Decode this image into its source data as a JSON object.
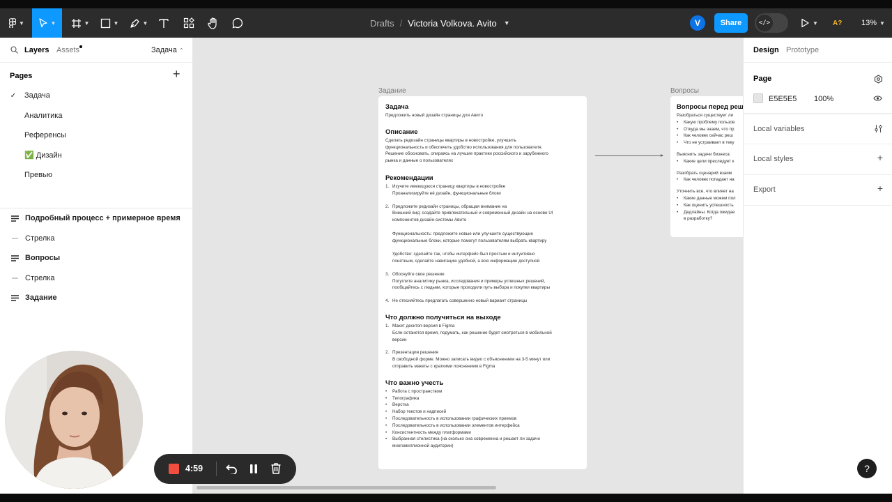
{
  "toolbar": {
    "breadcrumb_drafts": "Drafts",
    "breadcrumb_sep": "/",
    "file_name": "Victoria Volkova. Avito",
    "avatar_initial": "V",
    "share": "Share",
    "devmode_glyph": "</>",
    "ai": "A?",
    "zoom": "13%"
  },
  "left_panel": {
    "tab_layers": "Layers",
    "tab_assets": "Assets",
    "current_page": "Задача",
    "pages_heading": "Pages",
    "pages": [
      {
        "label": "Задача",
        "checked": true
      },
      {
        "label": "Аналитика"
      },
      {
        "label": "Референсы"
      },
      {
        "label": "✅ Дизайн"
      },
      {
        "label": "Превью"
      }
    ],
    "layers": [
      {
        "label": "Подробный процесс + примерное время",
        "type": "frame"
      },
      {
        "label": "Стрелка",
        "type": "line"
      },
      {
        "label": "Вопросы",
        "type": "frame"
      },
      {
        "label": "Стрелка",
        "type": "line"
      },
      {
        "label": "Задание",
        "type": "frame"
      }
    ]
  },
  "canvas": {
    "background": "#E5E5E5",
    "task_frame": {
      "label": "Задание",
      "title": "Задача",
      "subtitle": "Предложить новый дизайн страницы для Авито",
      "desc_heading": "Описание",
      "desc_lines": [
        "Сделать редизайн страницы квартиры в новостройке, улучшить",
        "функциональность и обеспечить удобство использования для пользователя.",
        "Решение обосновать, опираясь на лучшие практики российского и зарубежного",
        "рынка и данные о пользователях"
      ],
      "rec_heading": "Рекомендации",
      "rec_items": [
        {
          "n": "1.",
          "lines": [
            "Изучите имеющуюся страницу квартиры в новостройке",
            "Проанализируйте её дизайн, функциональные блоки"
          ]
        },
        {
          "n": "2.",
          "lines": [
            "Предложите редизайн страницы, обращая внимание на",
            "Внешний вид: создайте привлекательный и современный дизайн на основе UI",
            "компонентов дизайн-системы Авито",
            "",
            "Функциональность: предложите новые или улучшите существующие",
            "функциональные блоки, которые помогут пользователям выбрать квартиру",
            "",
            "Удобство: сделайте так, чтобы интерфейс был простым и интуитивно",
            "понятным, сделайте навигацию удобной, а всю информацию доступной"
          ]
        },
        {
          "n": "3.",
          "lines": [
            "Обоснуйте свое решение",
            "Погуглите аналитику рынка, исследования и примеры успешных решений,",
            "пообщайтесь с людьми, которые проходили путь выбора и покупки квартиры"
          ]
        },
        {
          "n": "4.",
          "lines": [
            "Не стесняйтесь предлагать совершенно новый вариант страницы"
          ]
        }
      ],
      "out_heading": "Что должно получиться на выходе",
      "out_items": [
        {
          "n": "1.",
          "lines": [
            "Макет десктоп-версия в Figma",
            "Если останется время, подумать, как решение будет смотреться в мобильной",
            "версии"
          ]
        },
        {
          "n": "2.",
          "lines": [
            "Презентация решения",
            "В свободной форме. Можно записать видео с объяснением на 3-5 минут или",
            "отправить макеты с краткими пояснением в Figma"
          ]
        }
      ],
      "consider_heading": "Что важно учесть",
      "consider_items": [
        "Работа с пространством",
        "Типографика",
        "Верстка",
        "Набор текстов и надписей",
        "Последовательность в использовании графических приемов",
        "Последовательность в использовании элементов интерфейса",
        "Консистентность между платформами",
        "Выбранная стилистика (на сколько она современна и решает ли задачи",
        "многомиллионной аудитории)"
      ]
    },
    "questions_frame": {
      "label": "Вопросы",
      "title": "Вопросы перед реш",
      "lines": [
        {
          "t": "Разобраться существует ли"
        },
        {
          "t": "Какую проблему пользов",
          "b": 1
        },
        {
          "t": "Откуда мы знаем, что пр",
          "b": 1
        },
        {
          "t": "Как человек сейчас реш",
          "b": 1
        },
        {
          "t": "Что не устраивает в теку",
          "b": 1
        },
        {
          "t": ""
        },
        {
          "t": "Выяснить задачи бизнеса:"
        },
        {
          "t": "Какие цели преследует к",
          "b": 1
        },
        {
          "t": ""
        },
        {
          "t": "Разобрать сценарий взаим"
        },
        {
          "t": "Как человек попадает на",
          "b": 1
        },
        {
          "t": ""
        },
        {
          "t": "Уточнить все, что влияет на"
        },
        {
          "t": "Какие данные можем пол",
          "b": 1
        },
        {
          "t": "Как оценить успешность",
          "b": 1
        },
        {
          "t": "Дедлайны. Когда ожидае",
          "b": 1
        },
        {
          "t": "в разработку?",
          "c": 1
        }
      ]
    }
  },
  "right_panel": {
    "tab_design": "Design",
    "tab_prototype": "Prototype",
    "page_heading": "Page",
    "page_color": "E5E5E5",
    "page_opacity": "100%",
    "local_variables": "Local variables",
    "local_styles": "Local styles",
    "export": "Export"
  },
  "help": "?",
  "recording": {
    "time": "4:59",
    "stop_color": "#F24E3F"
  }
}
